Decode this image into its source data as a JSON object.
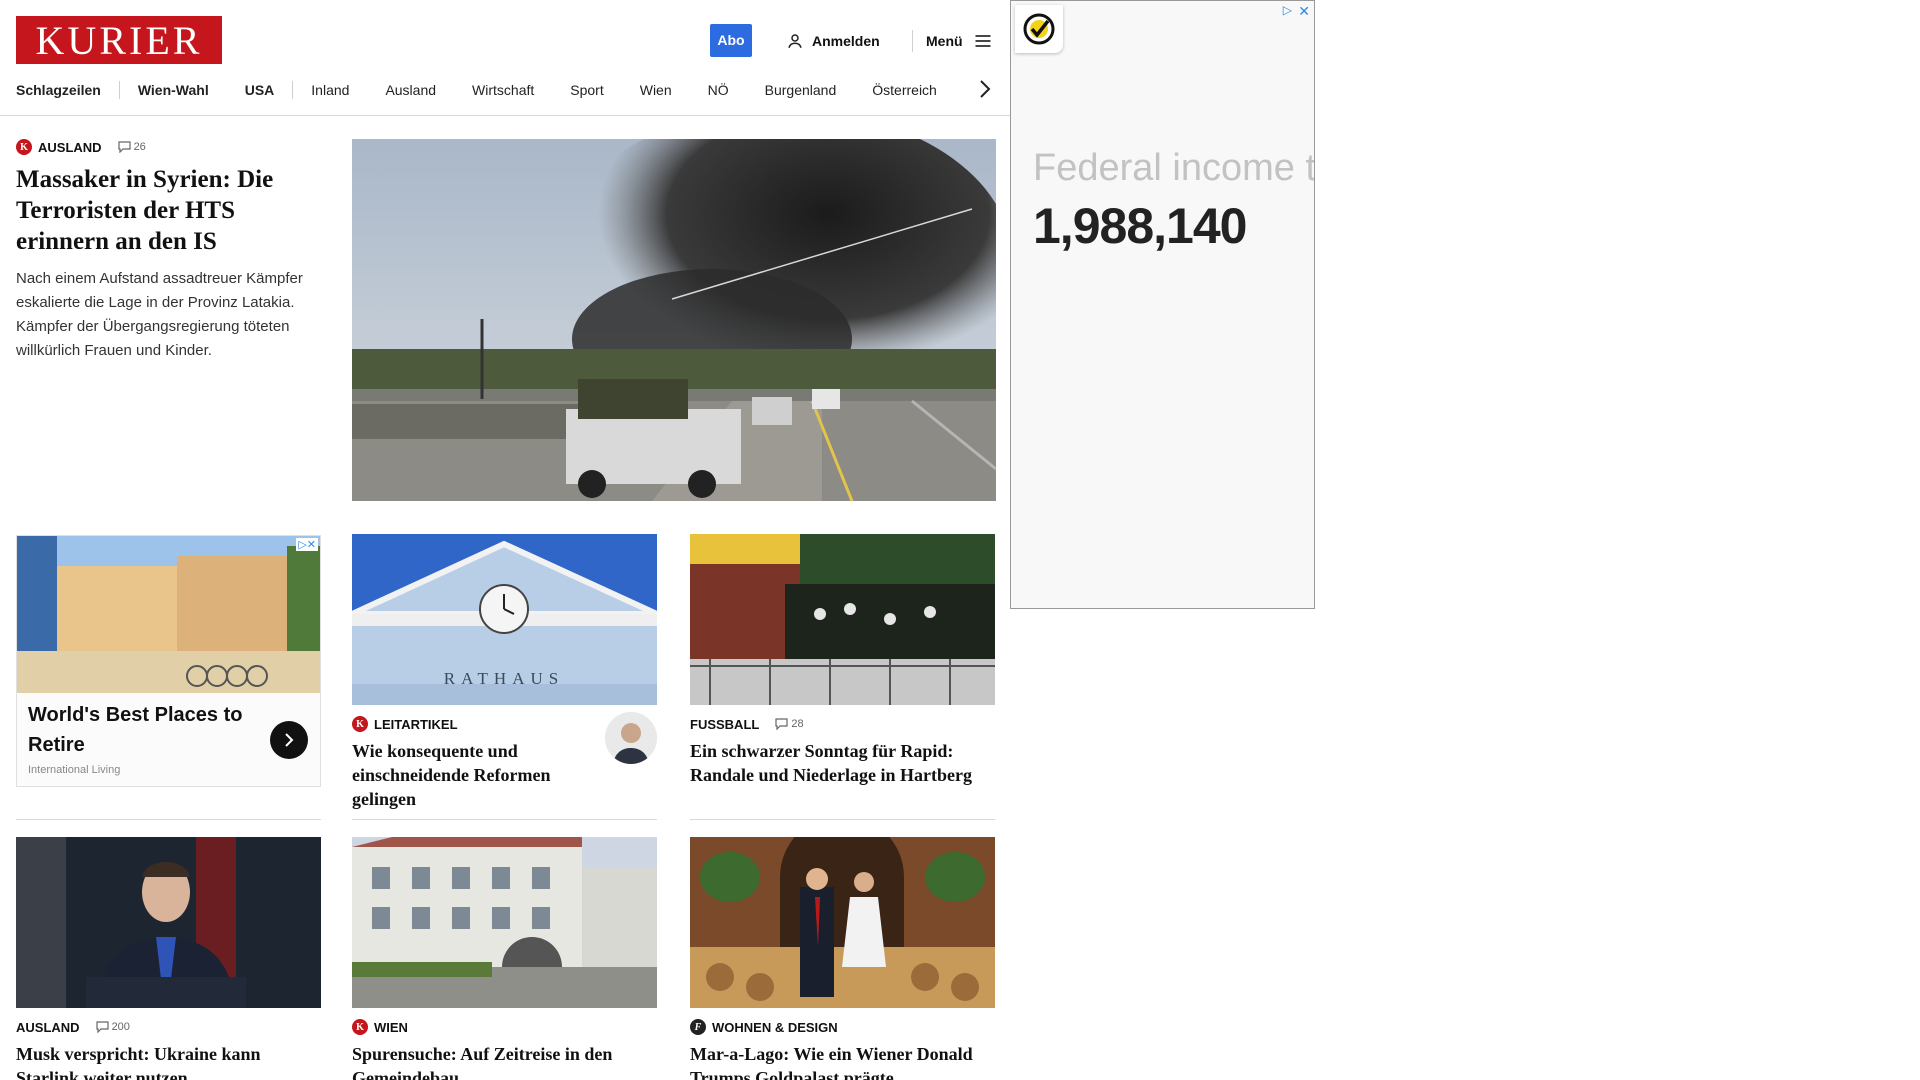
{
  "header": {
    "logo": "KURIER",
    "abo_label": "Abo",
    "login_label": "Anmelden",
    "menu_label": "Menü"
  },
  "nav": {
    "items": [
      "Schlagzeilen",
      "Wien-Wahl",
      "USA",
      "Inland",
      "Ausland",
      "Wirtschaft",
      "Sport",
      "Wien",
      "NÖ",
      "Burgenland",
      "Österreich"
    ]
  },
  "ad_right": {
    "title": "Federal income t",
    "number": "1,988,140"
  },
  "lead": {
    "kicker": "AUSLAND",
    "comments": "26",
    "title": "Massaker in Syrien: Die Terroristen der HTS erinnern an den IS",
    "text": "Nach einem Aufstand assadtreuer Kämpfer eskalierte die Lage in der Provinz Latakia. Kämpfer der Übergangsregierung töteten willkürlich Frauen und Kinder."
  },
  "ad_card": {
    "title": "World's Best Places to Retire",
    "source": "International Living"
  },
  "cards": [
    {
      "kicker": "LEITARTIKEL",
      "comments": "",
      "title": "Wie konsequente und einschneidende Reformen gelingen",
      "image_text": "RATHAUS"
    },
    {
      "kicker": "FUSSBALL",
      "comments": "28",
      "title": "Ein schwarzer Sonntag für Rapid: Randale und Niederlage in Hartberg"
    },
    {
      "kicker": "AUSLAND",
      "comments": "200",
      "title": "Musk verspricht: Ukraine kann Starlink weiter nutzen"
    },
    {
      "kicker": "WIEN",
      "comments": "",
      "title": "Spurensuche: Auf Zeitreise in den Gemeindebau"
    },
    {
      "kicker": "WOHNEN & DESIGN",
      "comments": "",
      "title": "Mar-a-Lago: Wie ein Wiener Donald Trumps Goldpalast prägte"
    }
  ],
  "colors": {
    "brand": "#c4161c",
    "abo": "#2d6be0"
  }
}
